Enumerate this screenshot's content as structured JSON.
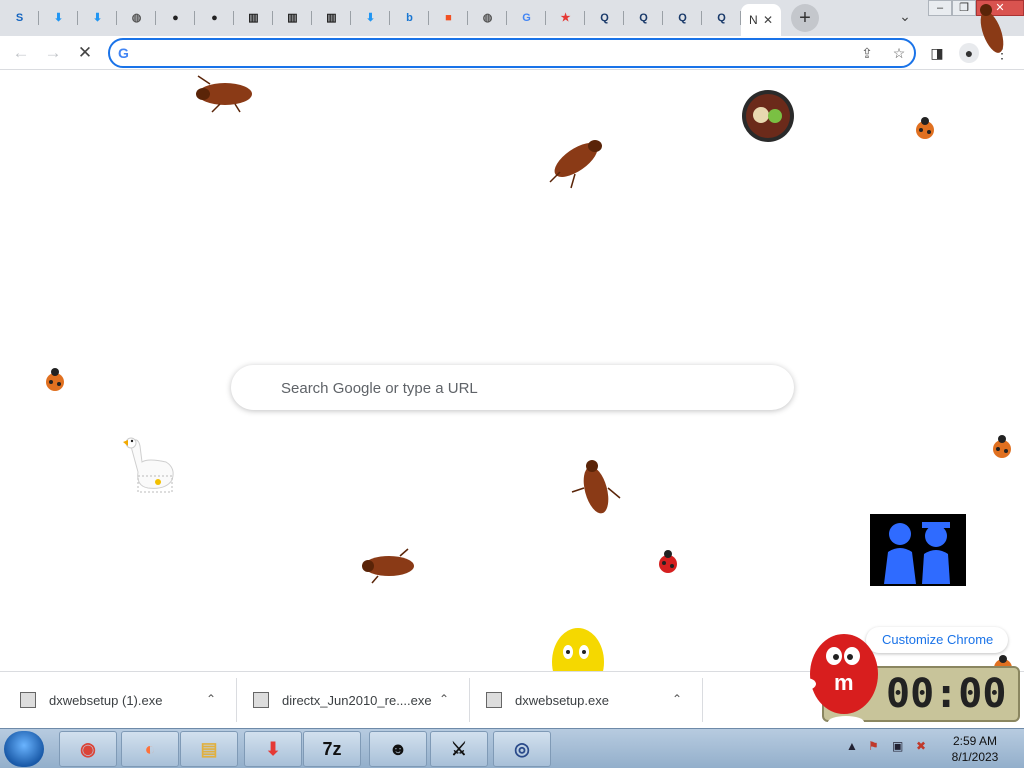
{
  "tabs": [
    {
      "icon": "s-logo-icon",
      "glyph": "S",
      "color": "#1565c0"
    },
    {
      "icon": "download-arrow-icon",
      "glyph": "⬇",
      "color": "#2196f3"
    },
    {
      "icon": "download-arrow-icon",
      "glyph": "⬇",
      "color": "#2196f3"
    },
    {
      "icon": "globe-icon",
      "glyph": "◍",
      "color": "#555555"
    },
    {
      "icon": "github-icon",
      "glyph": "●",
      "color": "#222222"
    },
    {
      "icon": "github-icon",
      "glyph": "●",
      "color": "#222222"
    },
    {
      "icon": "archive-icon",
      "glyph": "▥",
      "color": "#222222"
    },
    {
      "icon": "archive-icon",
      "glyph": "▥",
      "color": "#222222"
    },
    {
      "icon": "archive-icon",
      "glyph": "▥",
      "color": "#222222"
    },
    {
      "icon": "download-arrow-icon",
      "glyph": "⬇",
      "color": "#2196f3"
    },
    {
      "icon": "bing-icon",
      "glyph": "b",
      "color": "#1976d2"
    },
    {
      "icon": "microsoft-icon",
      "glyph": "■",
      "color": "#f25022"
    },
    {
      "icon": "globe-icon",
      "glyph": "◍",
      "color": "#555555"
    },
    {
      "icon": "google-icon",
      "glyph": "G",
      "color": "#4285f4"
    },
    {
      "icon": "star-icon",
      "glyph": "★",
      "color": "#e53935"
    },
    {
      "icon": "search-q-icon",
      "glyph": "Q",
      "color": "#1a3a6a"
    },
    {
      "icon": "search-q-icon",
      "glyph": "Q",
      "color": "#1a3a6a"
    },
    {
      "icon": "search-q-icon",
      "glyph": "Q",
      "color": "#1a3a6a"
    },
    {
      "icon": "search-q-icon",
      "glyph": "Q",
      "color": "#1a3a6a"
    }
  ],
  "active_tab": {
    "label": "N",
    "close": "✕"
  },
  "new_tab_glyph": "+",
  "tab_search_glyph": "⌄",
  "window_buttons": {
    "minimize": "–",
    "maximize": "❐",
    "close": "✕"
  },
  "toolbar": {
    "back": "←",
    "forward": "→",
    "reload": "✕",
    "omnibox_value": "",
    "share": "⇪",
    "bookmark": "☆",
    "side_panel": "◨",
    "profile": "●",
    "menu": "⋮"
  },
  "ntp": {
    "search_placeholder": "Search Google or type a URL",
    "customize": "Customize Chrome"
  },
  "downloads": [
    {
      "name": "dxwebsetup (1).exe"
    },
    {
      "name": "directx_Jun2010_re....exe"
    },
    {
      "name": "dxwebsetup.exe"
    }
  ],
  "download_chevron": "⌃",
  "taskbar": {
    "apps": [
      {
        "icon": "chrome-icon",
        "glyph": "◉",
        "color": "#db4437"
      },
      {
        "icon": "firefox-icon",
        "glyph": "◐",
        "color": "#ff7139"
      },
      {
        "icon": "file-explorer-icon",
        "glyph": "▤",
        "color": "#e0b040"
      },
      {
        "icon": "download-manager-icon",
        "glyph": "⬇",
        "color": "#e53935"
      },
      {
        "icon": "seven-zip-icon",
        "glyph": "7z",
        "color": "#111111"
      },
      {
        "icon": "badtz-maru-icon",
        "glyph": "☻",
        "color": "#111111"
      },
      {
        "icon": "sword-icon",
        "glyph": "⚔",
        "color": "#111111"
      },
      {
        "icon": "magnifier-app-icon",
        "glyph": "◎",
        "color": "#2a4a8a"
      }
    ],
    "tray": {
      "arrow": "▲",
      "flag": "⚑",
      "network": "▣",
      "volume": "✖"
    },
    "time": "2:59 AM",
    "date": "8/1/2023"
  },
  "clock_widget": "00:00"
}
